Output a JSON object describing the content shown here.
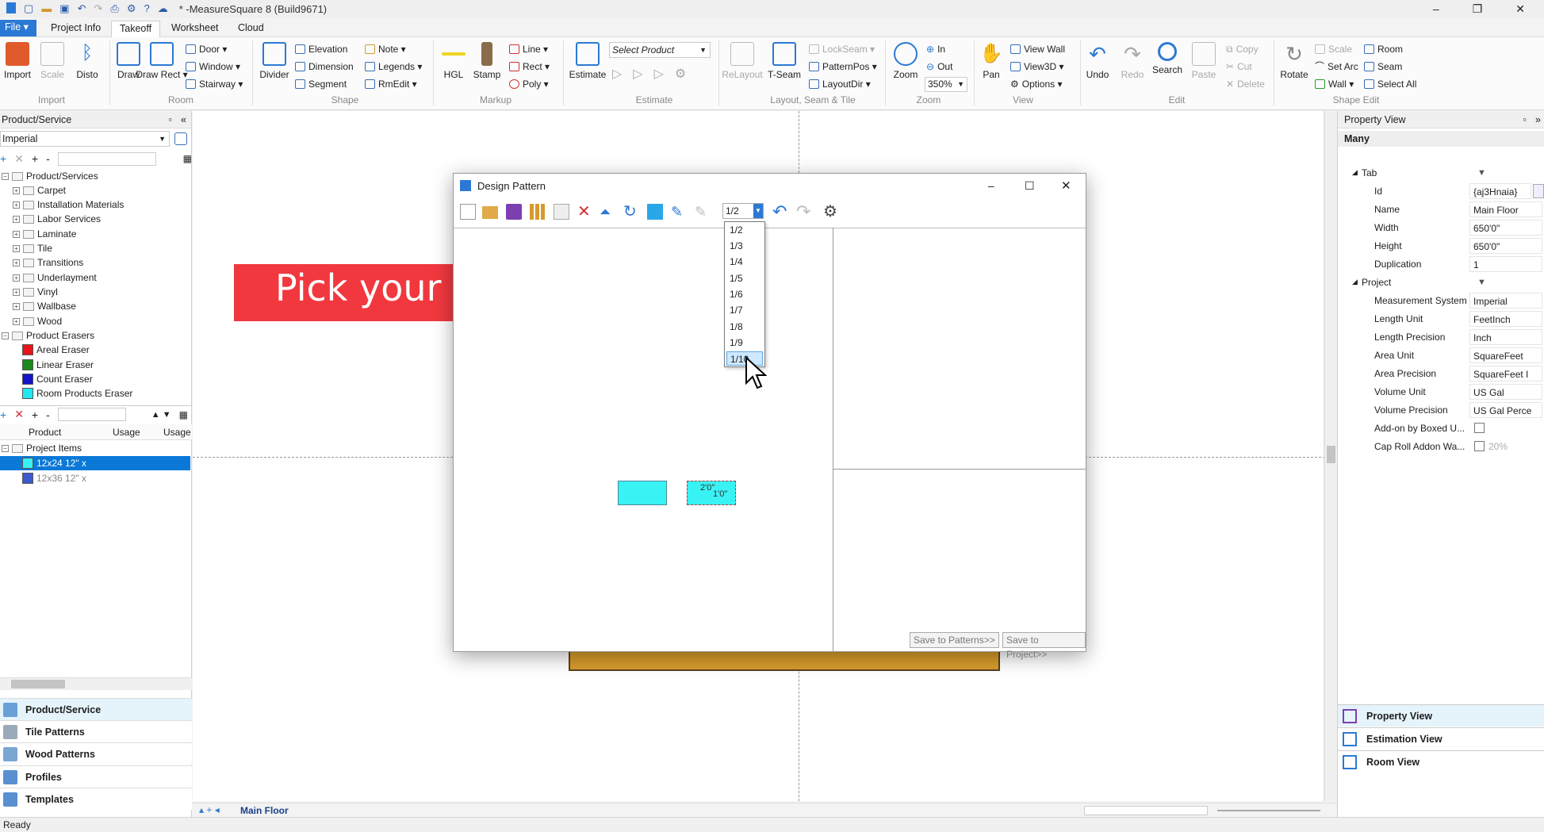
{
  "app": {
    "title": "* -MeasureSquare 8 (Build9671)"
  },
  "window_controls": {
    "minimize": "–",
    "maximize": "❐",
    "close": "✕"
  },
  "menu_tabs": [
    {
      "label": "File ▾"
    },
    {
      "label": "Project Info"
    },
    {
      "label": "Takeoff"
    },
    {
      "label": "Worksheet"
    },
    {
      "label": "Cloud"
    }
  ],
  "ribbon": {
    "buttons": {
      "import": "Import",
      "scale": "Scale",
      "disto": "Disto",
      "draw": "Draw",
      "draw_rect": "Draw Rect ▾",
      "divider": "Divider",
      "hgl": "HGL",
      "stamp": "Stamp",
      "estimate": "Estimate",
      "relayout": "ReLayout",
      "t_seam": "T-Seam",
      "zoom": "Zoom",
      "pan": "Pan",
      "undo": "Undo",
      "redo": "Redo",
      "search": "Search",
      "paste": "Paste",
      "rotate": "Rotate"
    },
    "small": {
      "door": "Door ▾",
      "window": "Window ▾",
      "stairway": "Stairway ▾",
      "elevation": "Elevation",
      "dimension": "Dimension",
      "segment": "Segment",
      "note": "Note ▾",
      "legends": "Legends ▾",
      "rmedit": "RmEdit ▾",
      "line": "Line ▾",
      "rect": "Rect ▾",
      "poly": "Poly ▾",
      "select_product": "Select Product",
      "lockseam": "LockSeam ▾",
      "patternpos": "PatternPos ▾",
      "layoutdir": "LayoutDir ▾",
      "zoom_in": "In",
      "zoom_out": "Out",
      "zoom_level": "350%",
      "view_wall": "View Wall",
      "view3d": "View3D ▾",
      "options": "Options ▾",
      "copy": "Copy",
      "cut": "Cut",
      "delete": "Delete",
      "scale2": "Scale",
      "set_arc": "Set Arc",
      "wall": "Wall ▾",
      "room": "Room",
      "seam": "Seam",
      "select_all": "Select All"
    },
    "groups": {
      "import": "Import",
      "room": "Room",
      "shape": "Shape",
      "markup": "Markup",
      "estimate": "Estimate",
      "layout": "Layout, Seam & Tile",
      "zoom": "Zoom",
      "view": "View",
      "edit": "Edit",
      "shape_edit": "Shape Edit"
    }
  },
  "left_panel": {
    "title": "Product/Service",
    "unit": "Imperial",
    "tree_root": "Product/Services",
    "categories": [
      "Carpet",
      "Installation Materials",
      "Labor Services",
      "Laminate",
      "Tile",
      "Transitions",
      "Underlayment",
      "Vinyl",
      "Wallbase",
      "Wood"
    ],
    "erasers_root": "Product Erasers",
    "erasers": [
      {
        "label": "Areal Eraser",
        "color": "#e8141a"
      },
      {
        "label": "Linear Eraser",
        "color": "#1a8a1a"
      },
      {
        "label": "Count Eraser",
        "color": "#1414c8"
      },
      {
        "label": "Room Products Eraser",
        "color": "#20e8f0"
      }
    ],
    "columns": [
      "Product",
      "Usage",
      "Usage"
    ],
    "project_root": "Project Items",
    "project_items": [
      {
        "label": "12x24 12\" x",
        "color": "#38f2f4",
        "selected": true
      },
      {
        "label": "12x36 12\" x",
        "color": "#3c5ad0",
        "selected": false
      }
    ],
    "nav": [
      "Product/Service",
      "Tile Patterns",
      "Wood Patterns",
      "Profiles",
      "Templates"
    ]
  },
  "canvas": {
    "annotation": "Pick your offset",
    "tile_labels": [
      "2'0\"",
      "1'0\""
    ]
  },
  "dialog": {
    "title": "Design Pattern",
    "offset_value": "1/2",
    "offset_options": [
      "1/2",
      "1/3",
      "1/4",
      "1/5",
      "1/6",
      "1/7",
      "1/8",
      "1/9",
      "1/10"
    ],
    "selected_option": "1/10",
    "save_patterns": "Save to Patterns>>",
    "save_project": "Save to Project>>"
  },
  "right_panel": {
    "title": "Property View",
    "many": "Many",
    "tab_section": "Tab",
    "tab_props": [
      {
        "key": "Id",
        "value": "{aj3Hnaia}"
      },
      {
        "key": "Name",
        "value": "Main Floor"
      },
      {
        "key": "Width",
        "value": "650'0\""
      },
      {
        "key": "Height",
        "value": "650'0\""
      },
      {
        "key": "Duplication",
        "value": "1"
      }
    ],
    "project_section": "Project",
    "project_props": [
      {
        "key": "Measurement System",
        "value": "Imperial"
      },
      {
        "key": "Length Unit",
        "value": "FeetInch"
      },
      {
        "key": "Length Precision",
        "value": "Inch"
      },
      {
        "key": "Area Unit",
        "value": "SquareFeet"
      },
      {
        "key": "Area Precision",
        "value": "SquareFeet I"
      },
      {
        "key": "Volume Unit",
        "value": "US Gal"
      },
      {
        "key": "Volume Precision",
        "value": "US Gal Perce"
      },
      {
        "key": "Add-on by Boxed U...",
        "value": ""
      },
      {
        "key": "Cap Roll Addon Wa...",
        "value": "20%"
      }
    ],
    "views": [
      "Property View",
      "Estimation View",
      "Room View"
    ]
  },
  "statusbar": {
    "status": "Ready",
    "floor_tab": "Main Floor"
  },
  "colors": {
    "accent": "#2b79d4",
    "arrow": "#f1383f",
    "tile": "#38f2f4",
    "selection": "#0a78d7"
  }
}
